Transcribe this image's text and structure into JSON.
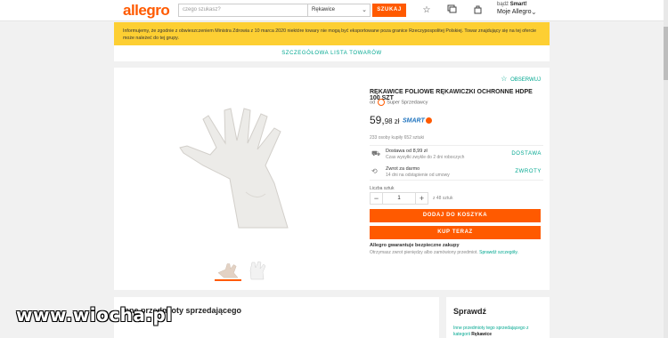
{
  "header": {
    "logo": "allegro",
    "search_placeholder": "czego szukasz?",
    "category": "Rękawice",
    "search_button": "SZUKAJ",
    "smart_prefix": "bądź",
    "smart_label": "Smart!",
    "account": "Moje Allegro"
  },
  "notice": "Informujemy, że zgodnie z obwieszczeniem Ministra Zdrowia z 10 marca 2020 niektóre towary nie mogą być eksportowane poza granice Rzeczypospolitej Polskiej. Towar znajdujący się na tej ofercie może należeć do tej grupy.",
  "list_link": "SZCZEGÓŁOWA LISTA TOWARÓW",
  "product": {
    "observe": "OBSERWUJ",
    "title": "RĘKAWICE FOLIOWE RĘKAWICZKI OCHRONNE HDPE 100 SZT",
    "seller_prefix": "od",
    "seller": "Super Sprzedawcy",
    "price_int": "59,",
    "price_dec": "98 zł",
    "smart": "SMART",
    "sold": "233 osoby kupiły 652 sztuki",
    "delivery_main": "Dostawa od 8,99 zł",
    "delivery_sub": "Czas wysyłki zwykle do 2 dni roboczych",
    "delivery_link": "DOSTAWA",
    "returns_main": "Zwrot za darmo",
    "returns_sub": "14 dni na odstąpienie od umowy",
    "returns_link": "ZWROTY",
    "qty_label": "Liczba sztuk",
    "qty_value": "1",
    "qty_of": "z 48 sztuk",
    "add_to_cart": "DODAJ DO KOSZYKA",
    "buy_now": "KUP TERAZ",
    "guarantee": "Allegro gwarantuje bezpieczne zakupy",
    "refund": "Otrzymasz zwrot pieniędzy albo zamówiony przedmiot.",
    "refund_link": "Sprawdź szczegóły."
  },
  "other": {
    "title": "Inne przedmioty sprzedającego"
  },
  "check": {
    "title": "Sprawdź",
    "text": "Inne przedmioty tego sprzedającego z kategorii",
    "category": "Rękawice"
  },
  "watermark": "www.wiocha.pl"
}
